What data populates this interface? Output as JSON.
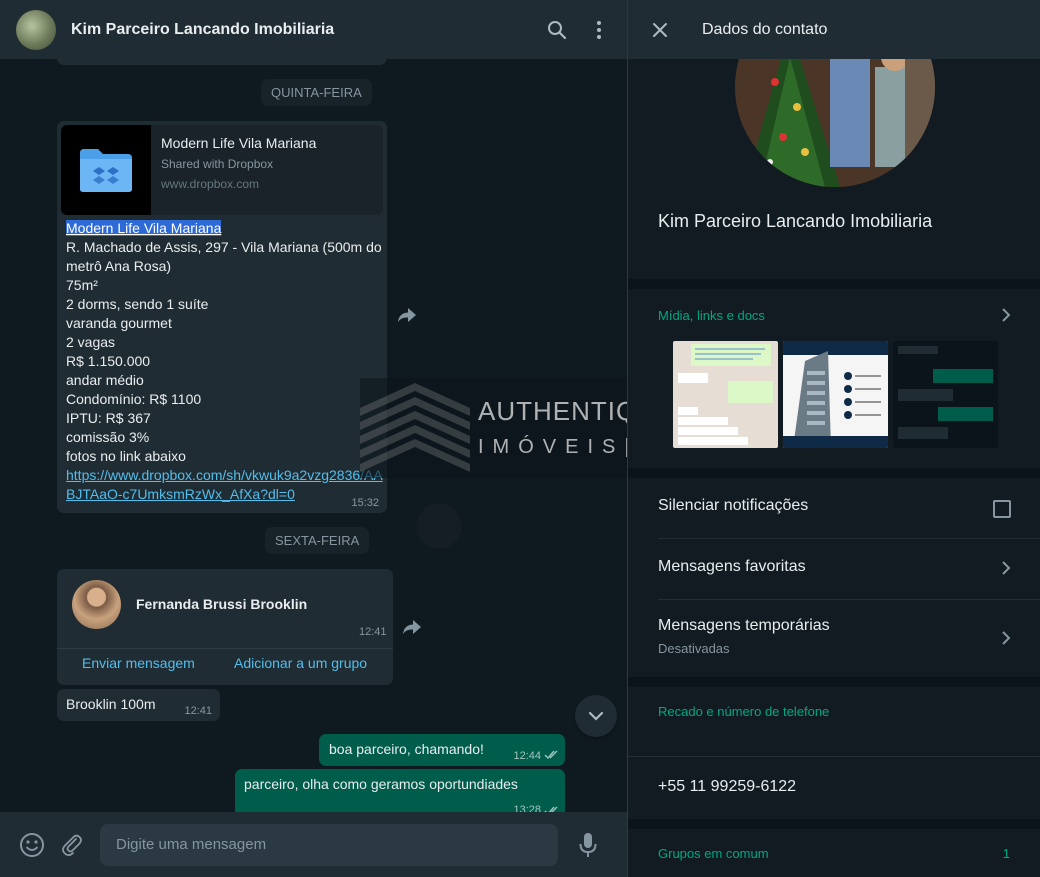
{
  "chat": {
    "title": "Kim Parceiro Lancando Imobiliaria",
    "day_thursday": "QUINTA-FEIRA",
    "day_friday": "SEXTA-FEIRA",
    "link_preview": {
      "title": "Modern Life Vila Mariana",
      "desc": "Shared with Dropbox",
      "url": "www.dropbox.com"
    },
    "message1": {
      "highlight": "Modern Life Vila Mariana",
      "lines": [
        "R. Machado de Assis, 297 - Vila Mariana (500m do metrô Ana Rosa)",
        "75m²",
        "2 dorms, sendo 1 suíte",
        "varanda gourmet",
        "2 vagas",
        "R$ 1.150.000",
        "andar médio",
        "Condomínio: R$ 1100",
        "IPTU: R$ 367",
        "comissão 3%",
        "fotos no link abaixo"
      ],
      "link": "https://www.dropbox.com/sh/vkwuk9a2vzg2836/AABJTAaO-c7UmksmRzWx_AfXa?dl=0",
      "time": "15:32"
    },
    "contact_card": {
      "name": "Fernanda Brussi Brooklin",
      "time": "12:41",
      "send_label": "Enviar mensagem",
      "add_group_label": "Adicionar a um grupo"
    },
    "message2": {
      "text": "Brooklin 100m",
      "time": "12:41"
    },
    "message3": {
      "text": "boa parceiro, chamando!",
      "time": "12:44"
    },
    "message4": {
      "text": "parceiro, olha como geramos oportundiades",
      "time": "13:28"
    },
    "input_placeholder": "Digite uma mensagem",
    "watermark": {
      "line1": "AUTHENTIQUE",
      "line2": "IMÓVEIS|SP"
    }
  },
  "contact_info": {
    "header_title": "Dados do contato",
    "name": "Kim Parceiro Lancando Imobiliaria",
    "media_label": "Mídia, links e docs",
    "mute_label": "Silenciar notificações",
    "starred_label": "Mensagens favoritas",
    "temp_label": "Mensagens temporárias",
    "temp_status": "Desativadas",
    "about_label": "Recado e número de telefone",
    "phone": "+55 11 99259-6122",
    "groups_label": "Grupos em comum",
    "groups_count": "1"
  },
  "colors": {
    "accent": "#00a884",
    "link": "#53bdeb",
    "outgoing_bubble": "#005c4b",
    "incoming_bubble": "#202c33"
  }
}
